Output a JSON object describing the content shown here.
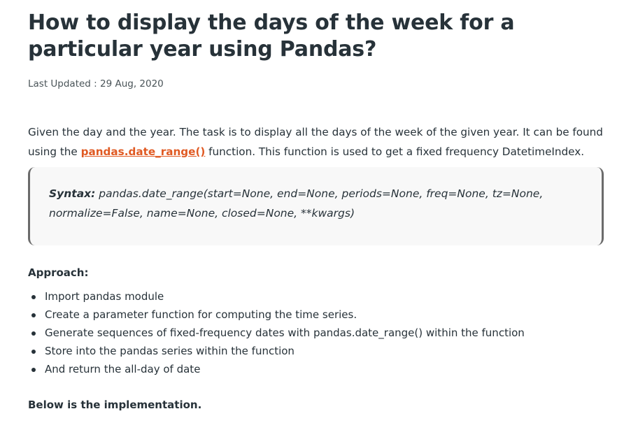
{
  "article": {
    "title": "How to display the days of the week for a particular year using Pandas?",
    "last_updated": "Last Updated : 29 Aug, 2020",
    "intro": {
      "before_link": "Given the day and the year. The task is to display all the days of the week of the given year. It can be found using the ",
      "link_text": "pandas.date_range()",
      "after_link": " function. This function is used to get a fixed frequency DatetimeIndex."
    },
    "syntax": {
      "label": "Syntax:",
      "signature": " pandas.date_range(start=None, end=None, periods=None, freq=None, tz=None, normalize=False, name=None, closed=None, **kwargs)"
    },
    "approach_heading": "Approach:",
    "approach_steps": [
      "Import pandas module",
      "Create a  parameter function for computing the time series.",
      "Generate sequences of fixed-frequency dates with pandas.date_range() within the function",
      "Store into the pandas series within the function",
      "And return the all-day of date"
    ],
    "implementation_heading": "Below is the implementation."
  },
  "colors": {
    "text": "#273239",
    "link": "#e05a23",
    "syntax_background": "#f8f8f8",
    "syntax_border": "#6b6b6b"
  }
}
